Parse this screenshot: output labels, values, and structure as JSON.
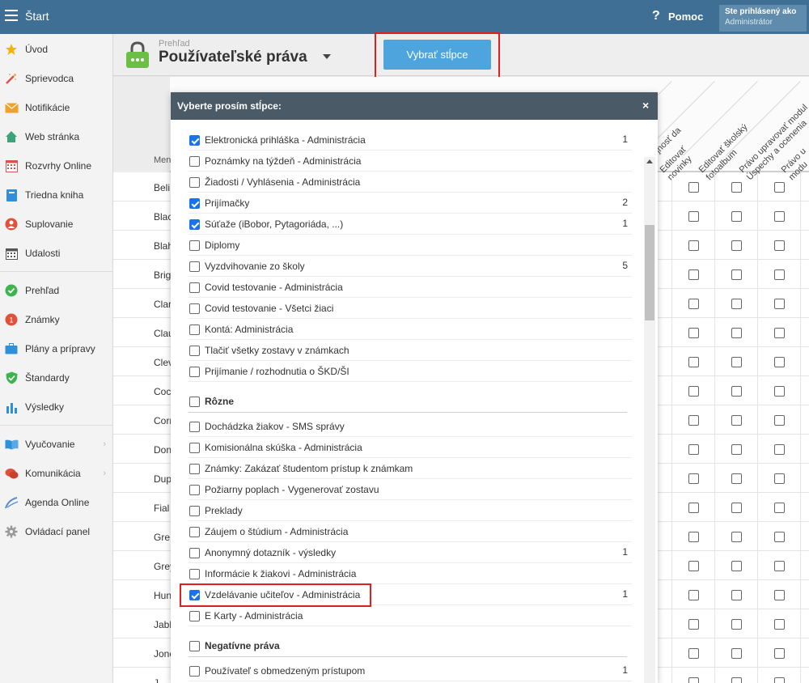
{
  "topbar": {
    "title": "Štart",
    "help_label": "Pomoc",
    "user_line1": "Ste prihlásený ako",
    "user_line2": "Administrátor"
  },
  "sidebar": {
    "items": [
      {
        "label": "Úvod",
        "icon": "star-icon"
      },
      {
        "label": "Sprievodca",
        "icon": "magic-wand-icon"
      },
      {
        "label": "Notifikácie",
        "icon": "envelope-icon"
      },
      {
        "label": "Web stránka",
        "icon": "home-icon"
      },
      {
        "label": "Rozvrhy Online",
        "icon": "calendar-grid-icon"
      },
      {
        "label": "Triedna kniha",
        "icon": "book-icon"
      },
      {
        "label": "Suplovanie",
        "icon": "person-icon"
      },
      {
        "label": "Udalosti",
        "icon": "calendar-icon"
      },
      {
        "label": "Prehľad",
        "icon": "check-circle-icon"
      },
      {
        "label": "Známky",
        "icon": "grades-icon"
      },
      {
        "label": "Plány a prípravy",
        "icon": "briefcase-icon"
      },
      {
        "label": "Štandardy",
        "icon": "shield-check-icon"
      },
      {
        "label": "Výsledky",
        "icon": "bar-chart-icon"
      },
      {
        "label": "Vyučovanie",
        "icon": "open-book-icon"
      },
      {
        "label": "Komunikácia",
        "icon": "chat-icon"
      },
      {
        "label": "Agenda Online",
        "icon": "pen-icon"
      },
      {
        "label": "Ovládací panel",
        "icon": "gear-icon"
      }
    ]
  },
  "page": {
    "breadcrumb": "Prehľad",
    "title": "Používateľské práva",
    "choose_button": "Vybrať stĺpce"
  },
  "table": {
    "name_header": "Men",
    "rows": [
      "Beli",
      "Blac",
      "Blah",
      "Brig",
      "Clar",
      "Clau",
      "Clev",
      "Coc",
      "Corr",
      "Don",
      "Dup",
      "Fial",
      "Gre",
      "Grey",
      "Hun",
      "Jabl",
      "Jone",
      "J"
    ],
    "column_headers": [
      "Editovať novinky",
      "Editovať školský fotoalbum",
      "Právo upravovať modul Úspechy a ocenenia",
      "Právo u modu"
    ],
    "partial_header": "ejnosť da"
  },
  "modal": {
    "title": "Vyberte prosím stĺpce:",
    "close": "×",
    "options": [
      {
        "label": "Elektronická prihláška - Administrácia",
        "checked": true,
        "count": "1"
      },
      {
        "label": "Poznámky na týždeň - Administrácia",
        "checked": false,
        "count": ""
      },
      {
        "label": "Žiadosti / Vyhlásenia - Administrácia",
        "checked": false,
        "count": ""
      },
      {
        "label": "Prijímačky",
        "checked": true,
        "count": "2"
      },
      {
        "label": "Súťaže (iBobor, Pytagoriáda, ...)",
        "checked": true,
        "count": "1"
      },
      {
        "label": "Diplomy",
        "checked": false,
        "count": ""
      },
      {
        "label": "Vyzdvihovanie zo školy",
        "checked": false,
        "count": "5"
      },
      {
        "label": "Covid testovanie - Administrácia",
        "checked": false,
        "count": ""
      },
      {
        "label": "Covid testovanie - Všetci žiaci",
        "checked": false,
        "count": ""
      },
      {
        "label": "Kontá: Administrácia",
        "checked": false,
        "count": ""
      },
      {
        "label": "Tlačiť všetky zostavy v známkach",
        "checked": false,
        "count": ""
      },
      {
        "label": "Prijímanie / rozhodnutia o ŠKD/ŠI",
        "checked": false,
        "count": ""
      }
    ],
    "section_rozne": "Rôzne",
    "options2": [
      {
        "label": "Dochádzka žiakov - SMS správy",
        "checked": false,
        "count": ""
      },
      {
        "label": "Komisionálna skúška - Administrácia",
        "checked": false,
        "count": ""
      },
      {
        "label": "Známky: Zakázať študentom prístup k známkam",
        "checked": false,
        "count": ""
      },
      {
        "label": "Požiarny poplach - Vygenerovať zostavu",
        "checked": false,
        "count": ""
      },
      {
        "label": "Preklady",
        "checked": false,
        "count": ""
      },
      {
        "label": "Záujem o štúdium - Administrácia",
        "checked": false,
        "count": ""
      },
      {
        "label": "Anonymný dotazník - výsledky",
        "checked": false,
        "count": "1"
      },
      {
        "label": "Informácie k žiakovi - Administrácia",
        "checked": false,
        "count": ""
      },
      {
        "label": "Vzdelávanie učiteľov - Administrácia",
        "checked": true,
        "count": "1"
      },
      {
        "label": "E Karty - Administrácia",
        "checked": false,
        "count": ""
      }
    ],
    "section_negativne": "Negatívne práva",
    "options3": [
      {
        "label": "Používateľ s obmedzeným prístupom",
        "checked": false,
        "count": "1"
      }
    ]
  },
  "colors": {
    "topbar": "#3f6f94",
    "accent_button": "#4ea5dd",
    "highlight": "#e0201e",
    "checkbox_checked": "#1a73e8"
  }
}
